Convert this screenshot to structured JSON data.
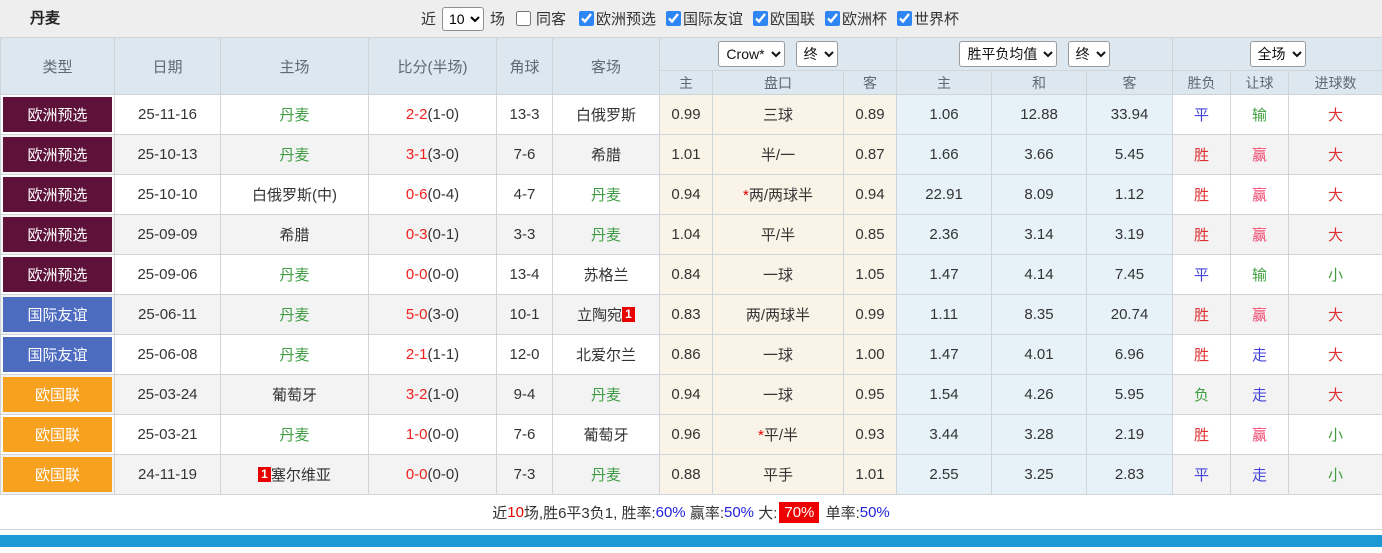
{
  "topbar": {
    "title": "丹麦",
    "recent_label": "近",
    "recent_value": "10",
    "matches_label": "场",
    "same_venue": {
      "label": "同客",
      "checked": false
    },
    "league_filters": [
      {
        "label": "欧洲预选",
        "checked": true
      },
      {
        "label": "国际友谊",
        "checked": true
      },
      {
        "label": "欧国联",
        "checked": true
      },
      {
        "label": "欧洲杯",
        "checked": true
      },
      {
        "label": "世界杯",
        "checked": true
      }
    ]
  },
  "table": {
    "main_headers": [
      "类型",
      "日期",
      "主场",
      "比分(半场)",
      "角球",
      "客场"
    ],
    "selects": {
      "bookmaker": "Crow*",
      "bookmaker_state": "终",
      "avg": "胜平负均值",
      "avg_state": "终",
      "scope": "全场"
    },
    "sub_headers": [
      "主",
      "盘口",
      "客",
      "主",
      "和",
      "客",
      "胜负",
      "让球",
      "进球数"
    ],
    "league_colors": {
      "欧洲预选": "#5e1239",
      "国际友谊": "#4d6cc0",
      "欧国联": "#f7a120"
    },
    "rows": [
      {
        "league": "欧洲预选",
        "date": "25-11-16",
        "home": {
          "name": "丹麦",
          "dk": true
        },
        "score": {
          "ft": "2-2",
          "ht": "(1-0)"
        },
        "corner": "13-3",
        "away": {
          "name": "白俄罗斯",
          "dk": false
        },
        "ah": {
          "home": "0.99",
          "line": "三球",
          "away": "0.89"
        },
        "odds": {
          "home": "1.06",
          "draw": "12.88",
          "away": "33.94"
        },
        "res": [
          {
            "t": "平",
            "c": "blue"
          },
          {
            "t": "输",
            "c": "green"
          },
          {
            "t": "大",
            "c": "red"
          }
        ]
      },
      {
        "league": "欧洲预选",
        "date": "25-10-13",
        "home": {
          "name": "丹麦",
          "dk": true
        },
        "score": {
          "ft": "3-1",
          "ht": "(3-0)"
        },
        "corner": "7-6",
        "away": {
          "name": "希腊",
          "dk": false
        },
        "ah": {
          "home": "1.01",
          "line": "半/一",
          "away": "0.87"
        },
        "odds": {
          "home": "1.66",
          "draw": "3.66",
          "away": "5.45"
        },
        "res": [
          {
            "t": "胜",
            "c": "red"
          },
          {
            "t": "赢",
            "c": "pink"
          },
          {
            "t": "大",
            "c": "red"
          }
        ]
      },
      {
        "league": "欧洲预选",
        "date": "25-10-10",
        "home": {
          "name": "白俄罗斯(中)",
          "dk": false
        },
        "score": {
          "ft": "0-6",
          "ht": "(0-4)"
        },
        "corner": "4-7",
        "away": {
          "name": "丹麦",
          "dk": true
        },
        "ah": {
          "home": "0.94",
          "star": "*",
          "line": "两/两球半",
          "away": "0.94"
        },
        "odds": {
          "home": "22.91",
          "draw": "8.09",
          "away": "1.12"
        },
        "res": [
          {
            "t": "胜",
            "c": "red"
          },
          {
            "t": "赢",
            "c": "pink"
          },
          {
            "t": "大",
            "c": "red"
          }
        ]
      },
      {
        "league": "欧洲预选",
        "date": "25-09-09",
        "home": {
          "name": "希腊",
          "dk": false
        },
        "score": {
          "ft": "0-3",
          "ht": "(0-1)"
        },
        "corner": "3-3",
        "away": {
          "name": "丹麦",
          "dk": true
        },
        "ah": {
          "home": "1.04",
          "line": "平/半",
          "away": "0.85"
        },
        "odds": {
          "home": "2.36",
          "draw": "3.14",
          "away": "3.19"
        },
        "res": [
          {
            "t": "胜",
            "c": "red"
          },
          {
            "t": "赢",
            "c": "pink"
          },
          {
            "t": "大",
            "c": "red"
          }
        ]
      },
      {
        "league": "欧洲预选",
        "date": "25-09-06",
        "home": {
          "name": "丹麦",
          "dk": true
        },
        "score": {
          "ft": "0-0",
          "ht": "(0-0)"
        },
        "corner": "13-4",
        "away": {
          "name": "苏格兰",
          "dk": false
        },
        "ah": {
          "home": "0.84",
          "line": "一球",
          "away": "1.05"
        },
        "odds": {
          "home": "1.47",
          "draw": "4.14",
          "away": "7.45"
        },
        "res": [
          {
            "t": "平",
            "c": "blue"
          },
          {
            "t": "输",
            "c": "green"
          },
          {
            "t": "小",
            "c": "green"
          }
        ]
      },
      {
        "league": "国际友谊",
        "date": "25-06-11",
        "home": {
          "name": "丹麦",
          "dk": true
        },
        "score": {
          "ft": "5-0",
          "ht": "(3-0)"
        },
        "corner": "10-1",
        "away": {
          "name": "立陶宛",
          "dk": false,
          "badge_after": "1"
        },
        "ah": {
          "home": "0.83",
          "line": "两/两球半",
          "away": "0.99"
        },
        "odds": {
          "home": "1.11",
          "draw": "8.35",
          "away": "20.74"
        },
        "res": [
          {
            "t": "胜",
            "c": "red"
          },
          {
            "t": "赢",
            "c": "pink"
          },
          {
            "t": "大",
            "c": "red"
          }
        ]
      },
      {
        "league": "国际友谊",
        "date": "25-06-08",
        "home": {
          "name": "丹麦",
          "dk": true
        },
        "score": {
          "ft": "2-1",
          "ht": "(1-1)"
        },
        "corner": "12-0",
        "away": {
          "name": "北爱尔兰",
          "dk": false
        },
        "ah": {
          "home": "0.86",
          "line": "一球",
          "away": "1.00"
        },
        "odds": {
          "home": "1.47",
          "draw": "4.01",
          "away": "6.96"
        },
        "res": [
          {
            "t": "胜",
            "c": "red"
          },
          {
            "t": "走",
            "c": "blue"
          },
          {
            "t": "大",
            "c": "red"
          }
        ]
      },
      {
        "league": "欧国联",
        "date": "25-03-24",
        "home": {
          "name": "葡萄牙",
          "dk": false
        },
        "score": {
          "ft": "3-2",
          "ht": "(1-0)"
        },
        "corner": "9-4",
        "away": {
          "name": "丹麦",
          "dk": true
        },
        "ah": {
          "home": "0.94",
          "line": "一球",
          "away": "0.95"
        },
        "odds": {
          "home": "1.54",
          "draw": "4.26",
          "away": "5.95"
        },
        "res": [
          {
            "t": "负",
            "c": "green"
          },
          {
            "t": "走",
            "c": "blue"
          },
          {
            "t": "大",
            "c": "red"
          }
        ]
      },
      {
        "league": "欧国联",
        "date": "25-03-21",
        "home": {
          "name": "丹麦",
          "dk": true
        },
        "score": {
          "ft": "1-0",
          "ht": "(0-0)"
        },
        "corner": "7-6",
        "away": {
          "name": "葡萄牙",
          "dk": false
        },
        "ah": {
          "home": "0.96",
          "star": "*",
          "line": "平/半",
          "away": "0.93"
        },
        "odds": {
          "home": "3.44",
          "draw": "3.28",
          "away": "2.19"
        },
        "res": [
          {
            "t": "胜",
            "c": "red"
          },
          {
            "t": "赢",
            "c": "pink"
          },
          {
            "t": "小",
            "c": "green"
          }
        ]
      },
      {
        "league": "欧国联",
        "date": "24-11-19",
        "home": {
          "name": "塞尔维亚",
          "dk": false,
          "badge_before": "1"
        },
        "score": {
          "ft": "0-0",
          "ht": "(0-0)"
        },
        "corner": "7-3",
        "away": {
          "name": "丹麦",
          "dk": true
        },
        "ah": {
          "home": "0.88",
          "line": "平手",
          "away": "1.01"
        },
        "odds": {
          "home": "2.55",
          "draw": "3.25",
          "away": "2.83"
        },
        "res": [
          {
            "t": "平",
            "c": "blue"
          },
          {
            "t": "走",
            "c": "blue"
          },
          {
            "t": "小",
            "c": "green"
          }
        ]
      }
    ]
  },
  "summary": {
    "segments": [
      {
        "t": "近",
        "c": "dark"
      },
      {
        "t": "10",
        "c": "red"
      },
      {
        "t": "场,胜6平3负1, 胜率:",
        "c": "dark"
      },
      {
        "t": "60%",
        "c": "blue"
      },
      {
        "t": " 赢率:",
        "c": "dark"
      },
      {
        "t": "50%",
        "c": "blue"
      },
      {
        "t": " 大:",
        "c": "dark"
      },
      {
        "t": "70%",
        "c": "badge"
      },
      {
        "t": " 单率:",
        "c": "dark"
      },
      {
        "t": "50%",
        "c": "blue"
      }
    ]
  },
  "colors": {
    "accent_bar": "#1d9ad6",
    "header_bg": "#dde7f0",
    "dk_green": "#3f9c43",
    "score_red": "#f3201f",
    "badge_red": "#e80000"
  }
}
